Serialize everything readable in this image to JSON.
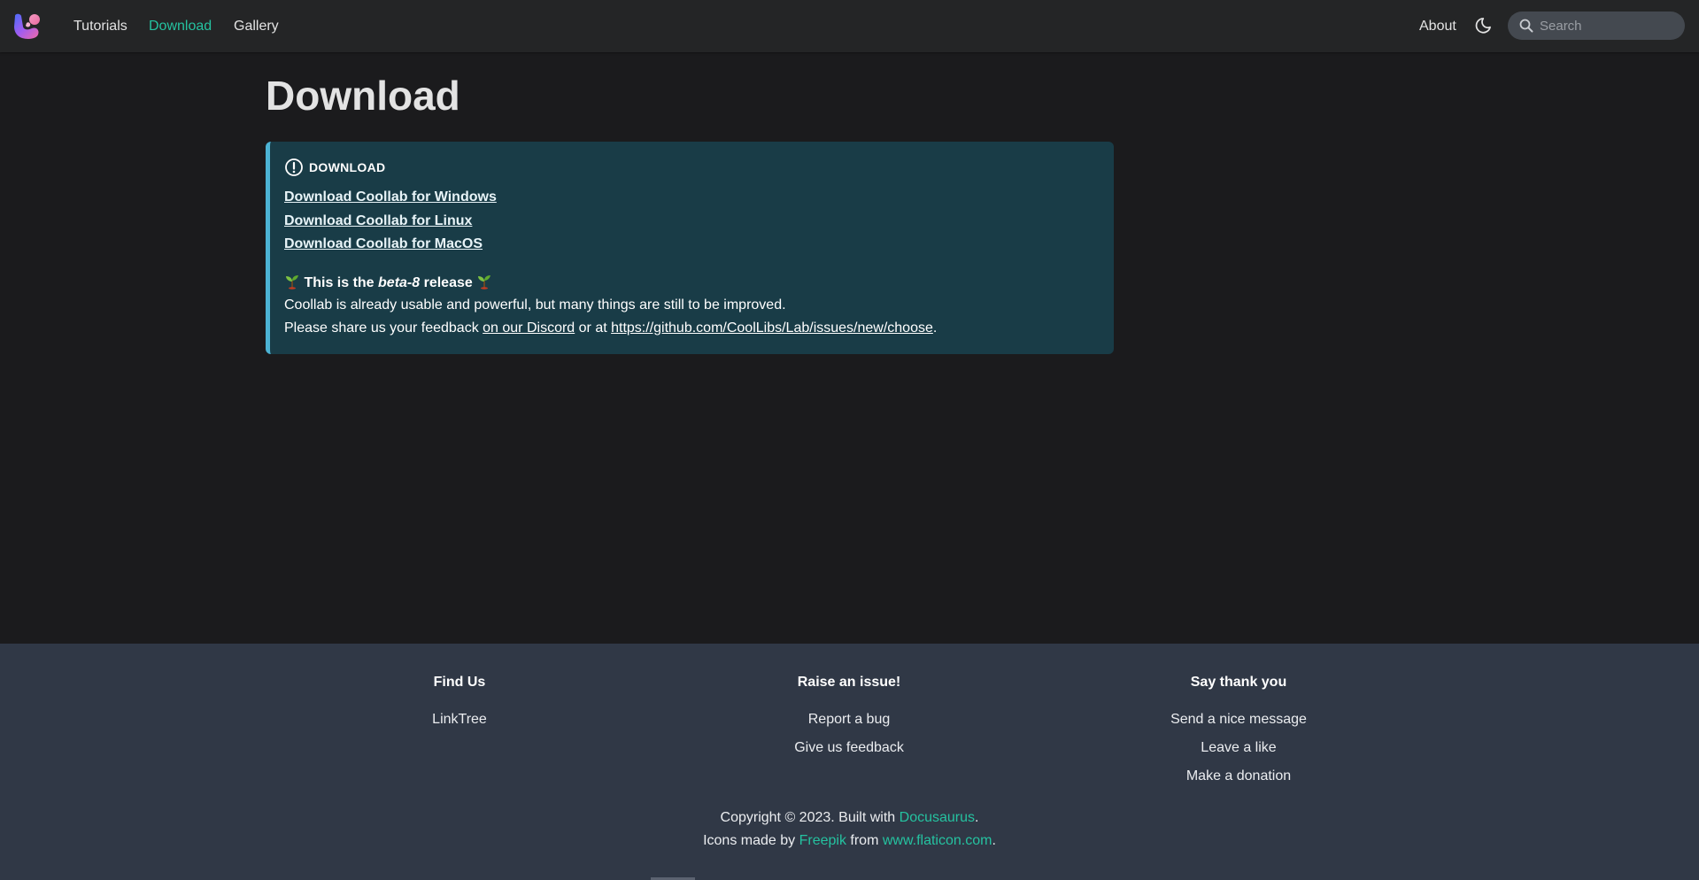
{
  "navbar": {
    "logo_icon": "coollab-logo-icon",
    "links": [
      {
        "label": "Tutorials",
        "active": false
      },
      {
        "label": "Download",
        "active": true
      },
      {
        "label": "Gallery",
        "active": false
      }
    ],
    "about_label": "About",
    "theme_toggle_icon": "moon-icon",
    "search": {
      "placeholder": "Search",
      "value": "",
      "icon": "search-icon"
    },
    "accent_color": "#25c2a0"
  },
  "main": {
    "title": "Download",
    "admonition": {
      "heading": "DOWNLOAD",
      "heading_icon": "info-circle-icon",
      "links": [
        "Download Coollab for Windows",
        "Download Coollab for Linux",
        "Download Coollab for MacOS"
      ],
      "release_prefix": "This is the",
      "release_version": "beta-8",
      "release_suffix": "release",
      "release_emoji_icon": "sprout-icon",
      "line1": "Coollab is already usable and powerful, but many things are still to be improved.",
      "line2_prefix": "Please share us your feedback",
      "discord_link": "on our Discord",
      "line2_middle": "or at",
      "github_link": "https://github.com/CoolLibs/Lab/issues/new/choose",
      "line2_suffix": ".",
      "background_color": "#193c47",
      "border_color": "#4cb3d4"
    }
  },
  "footer": {
    "columns": [
      {
        "title": "Find Us",
        "items": [
          "LinkTree"
        ]
      },
      {
        "title": "Raise an issue!",
        "items": [
          "Report a bug",
          "Give us feedback"
        ]
      },
      {
        "title": "Say thank you",
        "items": [
          "Send a nice message",
          "Leave a like",
          "Make a donation"
        ]
      }
    ],
    "copyright_prefix": "Copyright © 2023. Built with",
    "docusaurus_link": "Docusaurus",
    "period": ".",
    "icons_prefix": "Icons made by",
    "freepik_link": "Freepik",
    "icons_middle": "from",
    "flaticon_link": "www.flaticon.com",
    "background_color": "#303846"
  }
}
